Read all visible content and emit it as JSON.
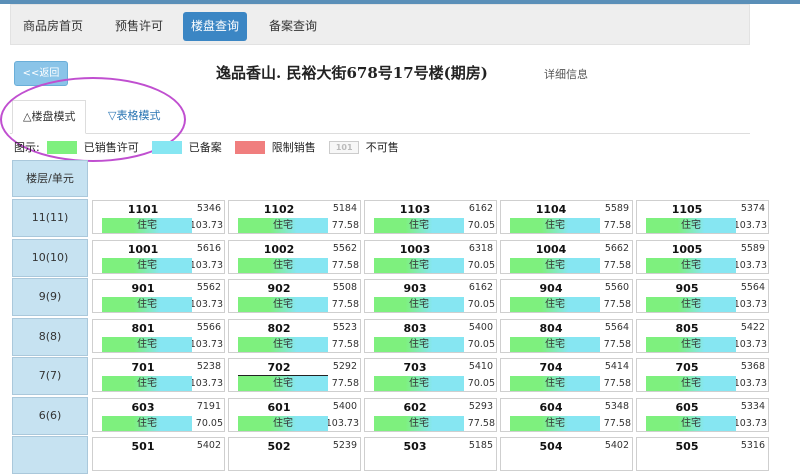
{
  "nav": {
    "items": [
      "商品房首页",
      "预售许可",
      "楼盘查询",
      "备案查询"
    ],
    "active": 2
  },
  "back_label": "<<返回",
  "page_title": "逸品香山. 民裕大街678号17号楼(期房)",
  "detail_link": "详细信息",
  "tabs": [
    "△楼盘模式",
    "▽表格模式"
  ],
  "legend": {
    "label": "图示:",
    "items": [
      {
        "label": "已销售许可",
        "color": "#7ef07e"
      },
      {
        "label": "已备案",
        "color": "#86e6f2"
      },
      {
        "label": "限制销售",
        "color": "#f07e7e"
      },
      {
        "label": "不可售",
        "color": "#f7f7f7",
        "swatch_text": "101"
      }
    ]
  },
  "colors": {
    "accent": "#3b86c4",
    "sale_permit": "#7ef07e",
    "filed": "#86e6f2",
    "restricted": "#f07e7e",
    "header_cell": "#c6e2f1"
  },
  "grid_header": "楼层/单元",
  "floors": [
    {
      "label": "11(11)",
      "units": [
        {
          "num": "1101",
          "price": "5346",
          "type": "住宅",
          "area": "103.73"
        },
        {
          "num": "1102",
          "price": "5184",
          "type": "住宅",
          "area": "77.58"
        },
        {
          "num": "1103",
          "price": "6162",
          "type": "住宅",
          "area": "70.05"
        },
        {
          "num": "1104",
          "price": "5589",
          "type": "住宅",
          "area": "77.58"
        },
        {
          "num": "1105",
          "price": "5374",
          "type": "住宅",
          "area": "103.73"
        }
      ]
    },
    {
      "label": "10(10)",
      "units": [
        {
          "num": "1001",
          "price": "5616",
          "type": "住宅",
          "area": "103.73"
        },
        {
          "num": "1002",
          "price": "5562",
          "type": "住宅",
          "area": "77.58"
        },
        {
          "num": "1003",
          "price": "6318",
          "type": "住宅",
          "area": "70.05"
        },
        {
          "num": "1004",
          "price": "5662",
          "type": "住宅",
          "area": "77.58"
        },
        {
          "num": "1005",
          "price": "5589",
          "type": "住宅",
          "area": "103.73"
        }
      ]
    },
    {
      "label": "9(9)",
      "units": [
        {
          "num": "901",
          "price": "5562",
          "type": "住宅",
          "area": "103.73"
        },
        {
          "num": "902",
          "price": "5508",
          "type": "住宅",
          "area": "77.58"
        },
        {
          "num": "903",
          "price": "6162",
          "type": "住宅",
          "area": "70.05"
        },
        {
          "num": "904",
          "price": "5560",
          "type": "住宅",
          "area": "77.58"
        },
        {
          "num": "905",
          "price": "5564",
          "type": "住宅",
          "area": "103.73"
        }
      ]
    },
    {
      "label": "8(8)",
      "units": [
        {
          "num": "801",
          "price": "5566",
          "type": "住宅",
          "area": "103.73"
        },
        {
          "num": "802",
          "price": "5523",
          "type": "住宅",
          "area": "77.58"
        },
        {
          "num": "803",
          "price": "5400",
          "type": "住宅",
          "area": "70.05"
        },
        {
          "num": "804",
          "price": "5564",
          "type": "住宅",
          "area": "77.58"
        },
        {
          "num": "805",
          "price": "5422",
          "type": "住宅",
          "area": "103.73"
        }
      ]
    },
    {
      "label": "7(7)",
      "units": [
        {
          "num": "701",
          "price": "5238",
          "type": "住宅",
          "area": "103.73"
        },
        {
          "num": "702",
          "price": "5292",
          "type": "住宅",
          "area": "77.58"
        },
        {
          "num": "703",
          "price": "5410",
          "type": "住宅",
          "area": "70.05"
        },
        {
          "num": "704",
          "price": "5414",
          "type": "住宅",
          "area": "77.58"
        },
        {
          "num": "705",
          "price": "5368",
          "type": "住宅",
          "area": "103.73"
        }
      ]
    },
    {
      "label": "6(6)",
      "units": [
        {
          "num": "603",
          "price": "7191",
          "type": "住宅",
          "area": "70.05"
        },
        {
          "num": "601",
          "price": "5400",
          "type": "住宅",
          "area": "103.73"
        },
        {
          "num": "602",
          "price": "5293",
          "type": "住宅",
          "area": "77.58"
        },
        {
          "num": "604",
          "price": "5348",
          "type": "住宅",
          "area": "77.58"
        },
        {
          "num": "605",
          "price": "5334",
          "type": "住宅",
          "area": "103.73"
        }
      ]
    },
    {
      "label": "",
      "units": [
        {
          "num": "501",
          "price": "5402",
          "type": "",
          "area": ""
        },
        {
          "num": "502",
          "price": "5239",
          "type": "",
          "area": ""
        },
        {
          "num": "503",
          "price": "5185",
          "type": "",
          "area": ""
        },
        {
          "num": "504",
          "price": "5402",
          "type": "",
          "area": ""
        },
        {
          "num": "505",
          "price": "5316",
          "type": "",
          "area": ""
        }
      ]
    }
  ]
}
